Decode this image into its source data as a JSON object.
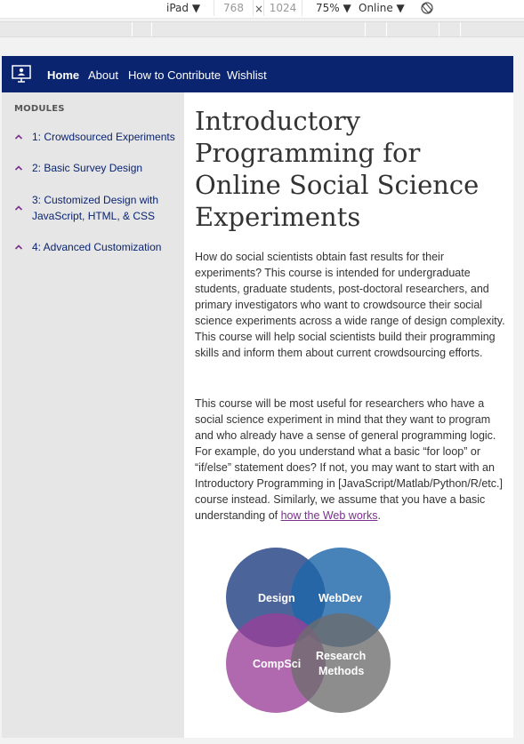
{
  "devtools": {
    "device": "iPad ▼",
    "width": "768",
    "separator": "×",
    "height": "1024",
    "zoom": "75% ▼",
    "network": "Online ▼"
  },
  "nav": {
    "home": "Home",
    "about": "About",
    "contribute": "How to Contribute",
    "wishlist": "Wishlist"
  },
  "sidebar": {
    "heading": "MODULES",
    "items": [
      {
        "label": "1: Crowdsourced Experiments"
      },
      {
        "label": "2: Basic Survey Design"
      },
      {
        "label": "3: Customized Design with JavaScript, HTML, & CSS"
      },
      {
        "label": "4: Advanced Customization"
      }
    ]
  },
  "main": {
    "title": "Introductory Programming for Online Social Science Experiments",
    "para1": "How do social scientists obtain fast results for their experiments? This course is intended for undergraduate students, graduate students, post-doctoral researchers, and primary investigators who want to crowdsource their social science experiments across a wide range of design complexity. This course will help social scientists build their programming skills and inform them about current crowdsourcing efforts.",
    "para2_text": "This course will be most useful for researchers who have a social science experiment in mind that they want to program and who already have a sense of general programming logic. For example, do you understand what a basic “for loop” or “if/else” statement does? If not, you may want to start with an Introductory Programming in [JavaScript/Matlab/Python/R/etc.] course instead. Similarly, we assume that you have a basic understanding of ",
    "para2_link": "how the Web works",
    "para2_end": "."
  },
  "venn": {
    "design": "Design",
    "webdev": "WebDev",
    "compsci": "CompSci",
    "research1": "Research",
    "research2": "Methods",
    "colors": {
      "design": "#2c4a8a",
      "webdev": "#1f66a8",
      "compsci": "#9a3f98",
      "research": "#6d6d6d"
    }
  },
  "colors": {
    "nav_bg": "#0a2470",
    "link": "#7b2f8f",
    "sidebar_bg": "#e6e6e6"
  }
}
